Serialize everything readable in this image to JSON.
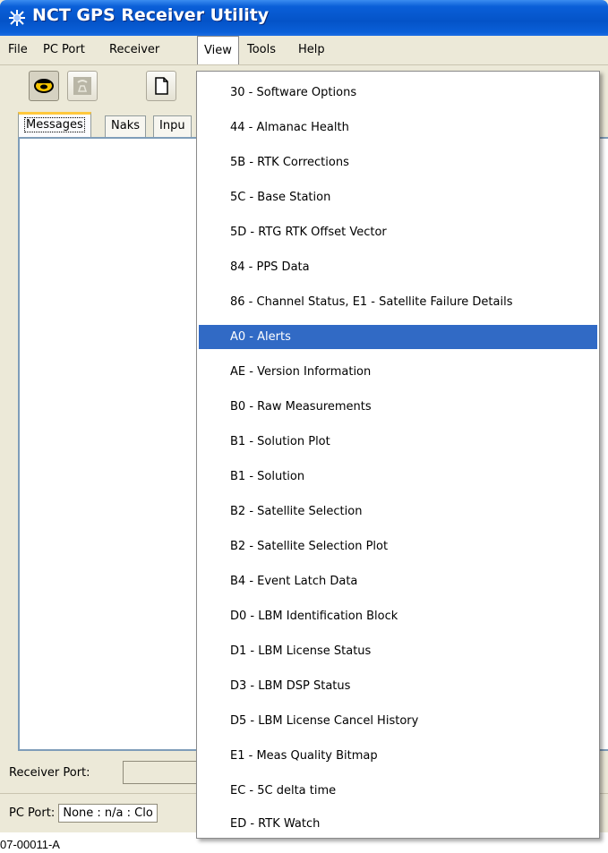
{
  "window": {
    "title": "NCT GPS Receiver Utility"
  },
  "menubar": {
    "items": [
      "File",
      "PC Port",
      "Receiver",
      "View",
      "Tools",
      "Help"
    ]
  },
  "toolbar": {
    "icons": [
      "phone-connect-icon",
      "phone-disconnect-icon",
      "new-document-icon"
    ]
  },
  "tabs": {
    "items": [
      "Messages",
      "Naks",
      "Inpu"
    ]
  },
  "status": {
    "receiver_port_label": "Receiver Port:",
    "pc_port_label": "PC Port:",
    "pc_port_value": "None : n/a : Clo"
  },
  "view_menu": {
    "items": [
      "30 - Software Options",
      "44 - Almanac Health",
      "5B - RTK Corrections",
      "5C - Base Station",
      "5D - RTG RTK Offset Vector",
      "84 - PPS Data",
      "86 - Channel Status, E1 - Satellite Failure Details",
      "A0 - Alerts",
      "AE - Version Information",
      "B0 - Raw Measurements",
      "B1 - Solution Plot",
      "B1 - Solution",
      "B2 - Satellite Selection",
      "B2 - Satellite Selection Plot",
      "B4 - Event Latch Data",
      "D0 - LBM Identification Block",
      "D1 - LBM License Status",
      "D3 - LBM DSP Status",
      "D5 - LBM License Cancel History",
      "E1 - Meas Quality Bitmap",
      "EC - 5C delta time",
      "ED - RTK Watch"
    ],
    "selected": "A0 - Alerts"
  },
  "figure_caption": "07-00011-A",
  "colors": {
    "titlebar": "#0453c8",
    "selection": "#316ac5",
    "window_bg": "#ece9d8"
  }
}
